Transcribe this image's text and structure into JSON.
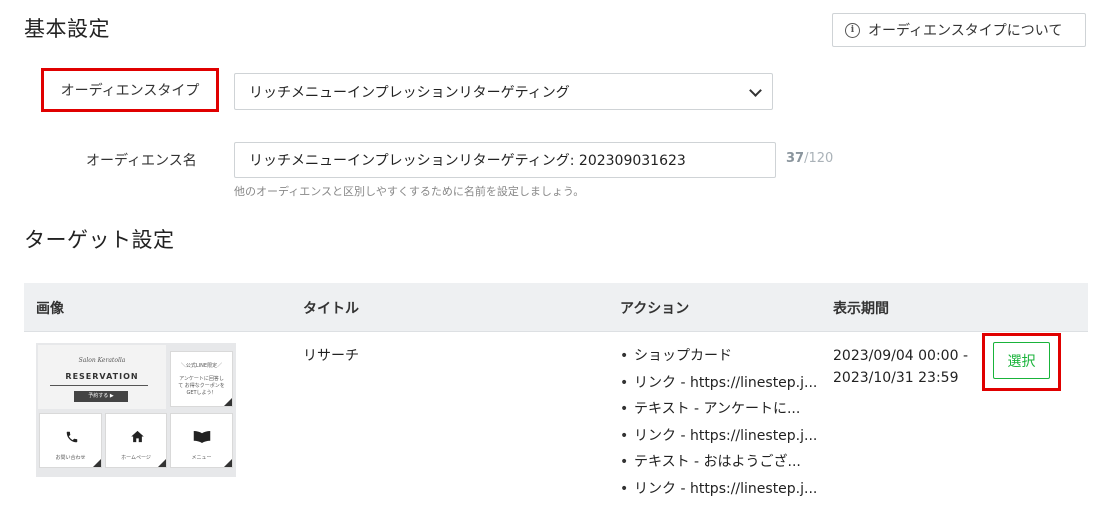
{
  "basic_settings": {
    "heading": "基本設定",
    "help_button": "オーディエンスタイプについて",
    "audience_type_label": "オーディエンスタイプ",
    "audience_type_value": "リッチメニューインプレッションリターゲティング",
    "audience_name_label": "オーディエンス名",
    "audience_name_value": "リッチメニューインプレッションリターゲティング: 202309031623",
    "char_count": "37",
    "char_limit": "/120",
    "hint": "他のオーディエンスと区別しやすくするために名前を設定しましょう。"
  },
  "target_settings": {
    "heading": "ターゲット設定",
    "columns": [
      "画像",
      "タイトル",
      "アクション",
      "表示期間"
    ],
    "row": {
      "title": "リサーチ",
      "actions": [
        "ショップカード",
        "リンク - https://linestep.j...",
        "テキスト - アンケートに...",
        "リンク - https://linestep.j...",
        "テキスト - おはようござ...",
        "リンク - https://linestep.j..."
      ],
      "period_start": "2023/09/04 00:00 -",
      "period_end": "2023/10/31 23:59",
      "select_button": "選択",
      "thumbnail": {
        "script_title": "Salon Keratolla",
        "reserve_title": "RESERVATION",
        "reserve_button": "予約する ▶",
        "line_promo": "＼公式LINE限定／",
        "line_promo_text": "アンケートに回答して お得なクーポンを GETしよう！",
        "tile_contact": "お問い合わせ",
        "tile_home": "ホームページ",
        "tile_menu": "メニュー"
      }
    }
  },
  "colors": {
    "highlight": "#e00000",
    "accent": "#19b33a",
    "table_header_bg": "#eef0f2"
  }
}
